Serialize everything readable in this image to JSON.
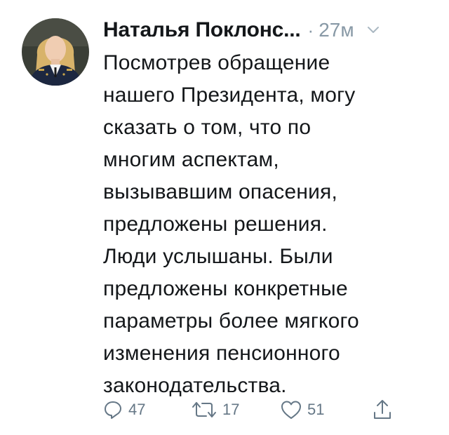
{
  "tweet": {
    "author_name": "Наталья Поклонс...",
    "separator": "·",
    "time": "27м",
    "text_lines": [
      "Посмотрев обращение",
      "нашего Президента, могу",
      "сказать о том, что по",
      "многим аспектам,",
      "вызывавшим опасения,",
      "предложены решения.",
      "Люди услышаны. Были",
      "предложены конкретные",
      "параметры более мягкого",
      "изменения пенсионного",
      "законодательства."
    ]
  },
  "actions": {
    "reply": {
      "icon": "reply-icon",
      "count": "47"
    },
    "retweet": {
      "icon": "retweet-icon",
      "count": "17"
    },
    "like": {
      "icon": "heart-icon",
      "count": "51"
    },
    "share": {
      "icon": "share-icon"
    }
  },
  "colors": {
    "text": "#14171a",
    "muted": "#8899a6",
    "icon": "#657786",
    "background": "#ffffff"
  }
}
